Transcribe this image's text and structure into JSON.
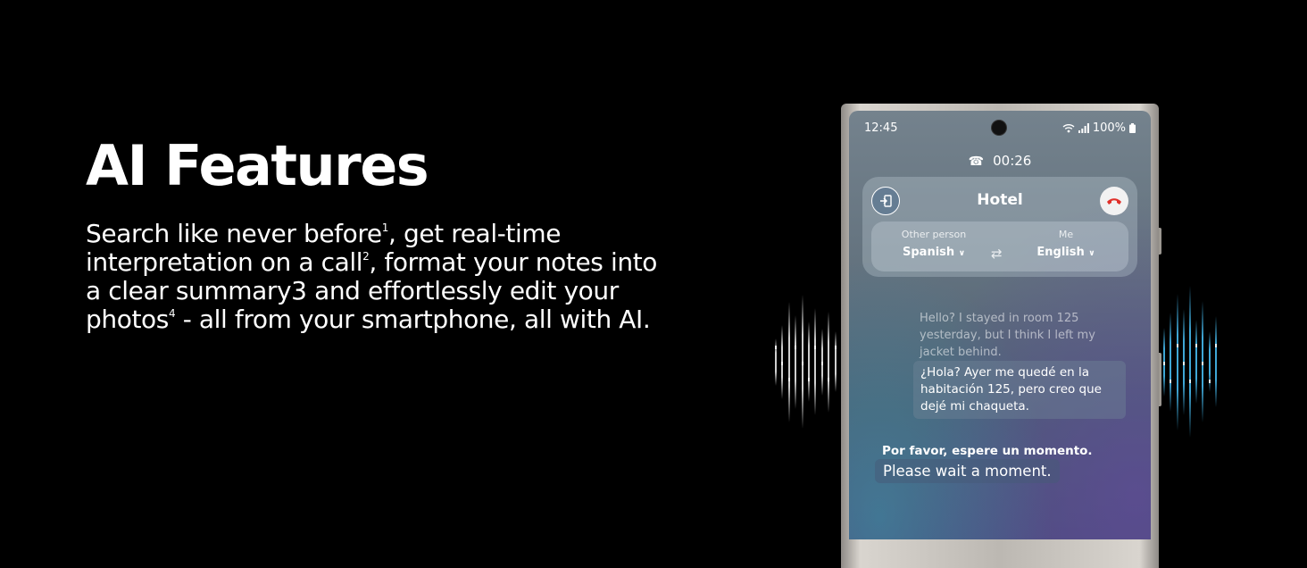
{
  "hero": {
    "title": "AI Features",
    "description": {
      "part1": "Search like never before",
      "sup1": "1",
      "part2": ", get real-time interpretation on a call",
      "sup2": "2",
      "part3": ", format your notes into a clear summary3 and effortlessly edit your photos",
      "sup4": "4",
      "part4": " - all from your smartphone, all with AI."
    }
  },
  "phone": {
    "status": {
      "time": "12:45",
      "battery": "100%"
    },
    "call": {
      "duration": "00:26",
      "title": "Hotel"
    },
    "languages": {
      "other_label": "Other person",
      "other_value": "Spanish",
      "me_label": "Me",
      "me_value": "English"
    },
    "messages": {
      "received_original": "Hello? I stayed in room 125 yesterday, but I think I left my jacket behind.",
      "received_translated": "¿Hola? Ayer me quedé en la habitación 125, pero creo que dejé mi chaqueta.",
      "reply_translated": "Por favor, espere un momento.",
      "reply_original": "Please wait a moment."
    }
  },
  "colors": {
    "background": "#000000",
    "end_call_red": "#e0302a",
    "wave_left": "#cfcfcf",
    "wave_right": "#3fa7d6"
  }
}
